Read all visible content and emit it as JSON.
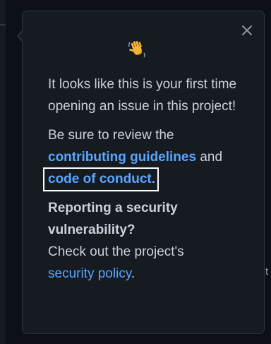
{
  "popover": {
    "close_label": "×",
    "intro_text": "It looks like this is your first time opening an issue in this project!",
    "review_prefix": "Be sure to review the",
    "contributing_link": "contributing guidelines",
    "review_and": "and",
    "conduct_link": "code of conduct.",
    "security_heading": "Reporting a security vulnerability?",
    "security_prefix": "Check out the project's",
    "security_link": "security policy",
    "security_suffix": "."
  },
  "backdrop": {
    "stray_letter": "t"
  },
  "icons": {
    "wave": "waving-hand-icon",
    "close": "close-icon"
  },
  "colors": {
    "link": "#58a6ff",
    "text": "#c9d1d9",
    "panel": "#161b22",
    "border": "#30363d",
    "page": "#0d1117"
  }
}
